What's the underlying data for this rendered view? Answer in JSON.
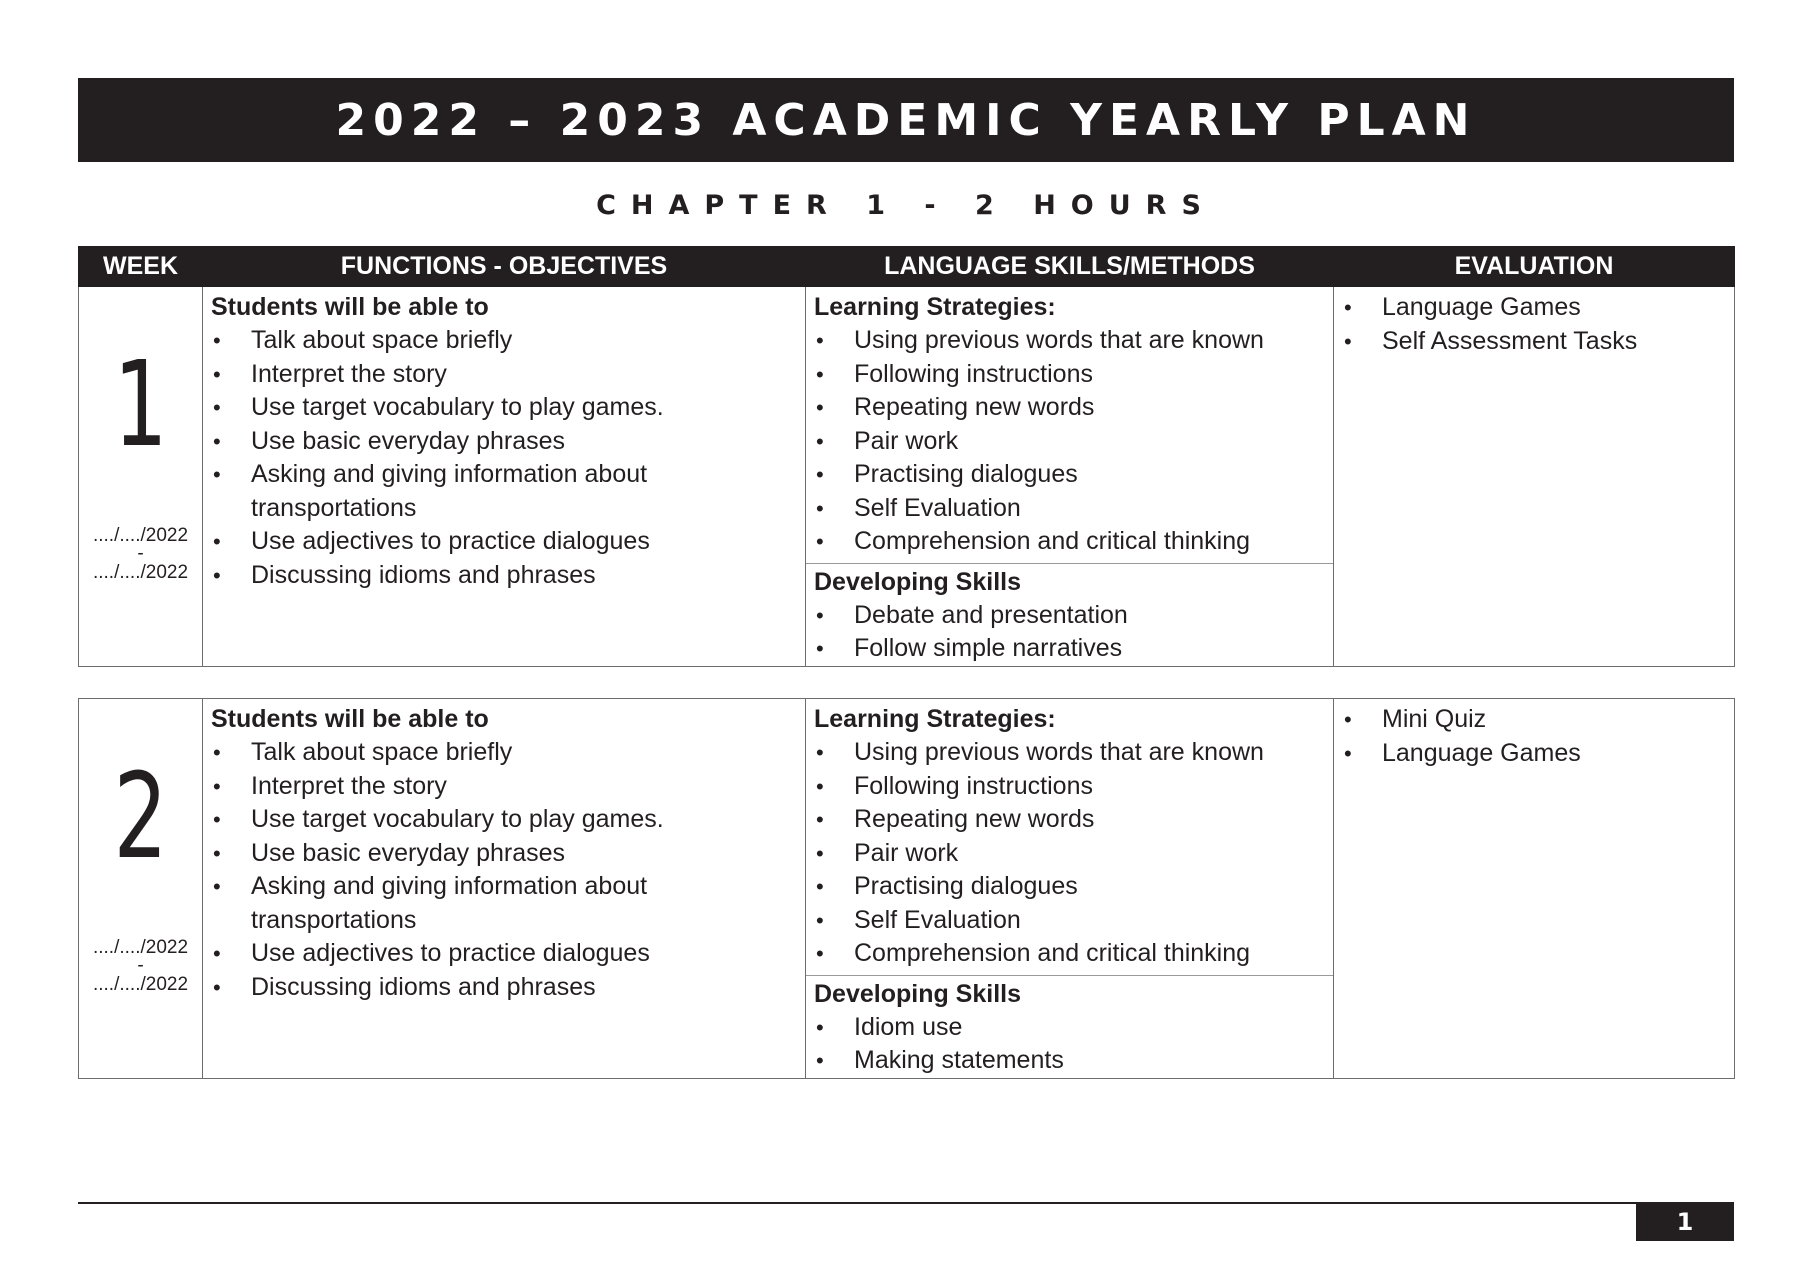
{
  "title": "2022 – 2023 ACADEMIC YEARLY PLAN",
  "chapter": "CHAPTER 1 - 2 HOURS",
  "columns": {
    "week": "WEEK",
    "objectives": "FUNCTIONS - OBJECTIVES",
    "skills": "LANGUAGE SKILLS/METHODS",
    "evaluation": "EVALUATION"
  },
  "weeks": [
    {
      "number": "1",
      "date_start": "..../..../2022",
      "date_sep": "-",
      "date_end": "..../..../2022",
      "objectives_heading": "Students will be able to",
      "objectives": [
        "Talk about space briefly",
        "Interpret the story",
        "Use target vocabulary to play games.",
        "Use basic everyday phrases",
        "Asking and giving information about transportations",
        "Use adjectives to practice dialogues",
        "Discussing idioms and phrases"
      ],
      "strategies_heading": "Learning Strategies:",
      "strategies": [
        "Using previous words that are known",
        "Following instructions",
        "Repeating new words",
        "Pair work",
        "Practising dialogues",
        "Self Evaluation",
        "Comprehension and critical thinking"
      ],
      "developing_heading": "Developing Skills",
      "developing": [
        "Debate and presentation",
        "Follow simple narratives"
      ],
      "evaluation": [
        "Language Games",
        "Self Assessment Tasks"
      ]
    },
    {
      "number": "2",
      "date_start": "..../..../2022",
      "date_sep": "-",
      "date_end": "..../..../2022",
      "objectives_heading": "Students will be able to",
      "objectives": [
        "Talk about space briefly",
        "Interpret the story",
        "Use target vocabulary to play games.",
        "Use basic everyday phrases",
        "Asking and giving information about transportations",
        "Use adjectives to practice dialogues",
        "Discussing idioms and phrases"
      ],
      "strategies_heading": "Learning Strategies:",
      "strategies": [
        "Using previous words that are known",
        "Following instructions",
        "Repeating new words",
        "Pair work",
        "Practising dialogues",
        "Self Evaluation",
        "Comprehension and critical thinking"
      ],
      "developing_heading": "Developing Skills",
      "developing": [
        "Idiom use",
        "Making statements"
      ],
      "evaluation": [
        "Mini Quiz",
        "Language Games"
      ]
    }
  ],
  "page_number": "1"
}
